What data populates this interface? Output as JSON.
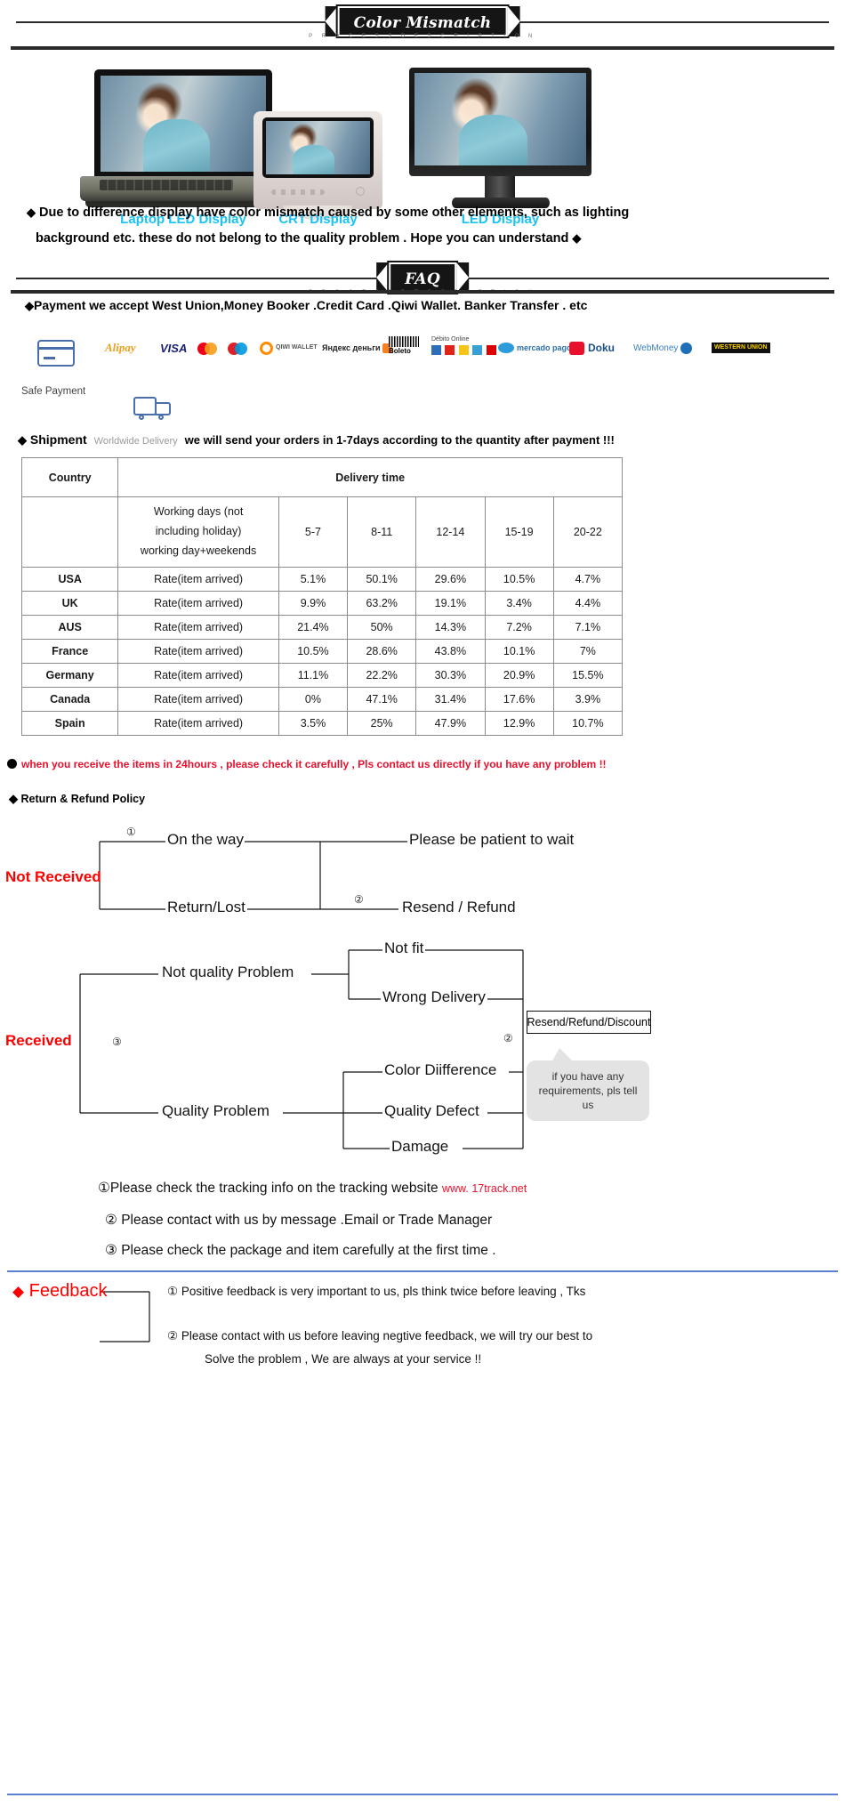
{
  "banners": [
    {
      "title": "Color Mismatch",
      "subtitle": "P R O C E S S   D E S C R I P T I O N"
    },
    {
      "title": "FAQ",
      "subtitle": "P R O C E S S   D E S C R I P T I O N"
    }
  ],
  "monitors": [
    {
      "label": "Laptop LED Display"
    },
    {
      "label": "CRT Display"
    },
    {
      "label": "LED  Display"
    }
  ],
  "color_mismatch": {
    "line1": "Due to difference display have color mismatch caused by some other elements, such as lighting",
    "line2": "background etc.  these do not belong to the quality problem . Hope you can understand",
    "diamond": "◆"
  },
  "payment": {
    "heading": "Payment we accept West Union,Money Booker .Credit Card .Qiwi Wallet. Banker Transfer . etc",
    "safe_payment_label": "Safe Payment",
    "logos": [
      {
        "name": "alipay",
        "text": "Alipay"
      },
      {
        "name": "visa",
        "text": "VISA"
      },
      {
        "name": "mastercard",
        "text": ""
      },
      {
        "name": "maestro",
        "text": ""
      },
      {
        "name": "qiwi-wallet",
        "text": "QIWI WALLET"
      },
      {
        "name": "yandex-dengi",
        "text": "Яндекс деньги"
      },
      {
        "name": "boleto",
        "text": "Boleto"
      },
      {
        "name": "debito-online",
        "text": "Débito Online"
      },
      {
        "name": "mercado-pago",
        "text": "mercado pago"
      },
      {
        "name": "doku",
        "text": "Doku"
      },
      {
        "name": "webmoney",
        "text": "WebMoney"
      },
      {
        "name": "western-union",
        "text": "WESTERN UNION"
      }
    ]
  },
  "shipment": {
    "title": "Shipment",
    "worldwide": "Worldwide Delivery",
    "note": "we will send your orders in 1-7days according to the quantity after payment  !!!"
  },
  "table": {
    "header": {
      "country": "Country",
      "delivery_time": "Delivery time"
    },
    "subheader": {
      "working_days": [
        "Working days (not",
        "including holiday)",
        "working day+weekends"
      ],
      "ranges": [
        "5-7",
        "8-11",
        "12-14",
        "15-19",
        "20-22"
      ]
    },
    "rate_label": "Rate(item arrived)",
    "rows": [
      {
        "country": "USA",
        "rate": "Rate(item arrived)",
        "values": [
          "5.1%",
          "50.1%",
          "29.6%",
          "10.5%",
          "4.7%"
        ]
      },
      {
        "country": "UK",
        "rate": "Rate(item arrived)",
        "values": [
          "9.9%",
          "63.2%",
          "19.1%",
          "3.4%",
          "4.4%"
        ]
      },
      {
        "country": "AUS",
        "rate": "Rate(item arrived)",
        "values": [
          "21.4%",
          "50%",
          "14.3%",
          "7.2%",
          "7.1%"
        ]
      },
      {
        "country": "France",
        "rate": "Rate(item arrived)",
        "values": [
          "10.5%",
          "28.6%",
          "43.8%",
          "10.1%",
          "7%"
        ]
      },
      {
        "country": "Germany",
        "rate": "Rate(item arrived)",
        "values": [
          "11.1%",
          "22.2%",
          "30.3%",
          "20.9%",
          "15.5%"
        ]
      },
      {
        "country": "Canada",
        "rate": "Rate(item arrived)",
        "values": [
          "0%",
          "47.1%",
          "31.4%",
          "17.6%",
          "3.9%"
        ]
      },
      {
        "country": "Spain",
        "rate": "Rate(item arrived)",
        "values": [
          "3.5%",
          "25%",
          "47.9%",
          "12.9%",
          "10.7%"
        ]
      }
    ]
  },
  "warning": "when you receive the items in 24hours , please check it carefully , Pls contact us directly if you have any problem !!",
  "return_policy_title": "Return & Refund Policy",
  "flow_not_received": {
    "group_label": "Not Received",
    "node_on_the_way": "On the way",
    "node_return_lost": "Return/Lost",
    "out_patient": "Please be patient to wait",
    "out_resend_refund": "Resend / Refund",
    "marker_1": "①",
    "marker_2": "②"
  },
  "flow_received": {
    "group_label": "Received",
    "node_not_quality": "Not quality Problem",
    "node_quality": "Quality Problem",
    "leaf_not_fit": "Not fit",
    "leaf_wrong_delivery": "Wrong Delivery",
    "leaf_color_difference": "Color Diifference",
    "leaf_quality_defect": "Quality Defect",
    "leaf_damage": "Damage",
    "result_box": "Resend/Refund/Discount",
    "bubble": "if you have any requirements, pls tell us",
    "marker_2": "②",
    "marker_3": "③"
  },
  "explanations": [
    {
      "marker": "①",
      "text": "Please check the tracking info on the tracking website",
      "link": "www. 17track.net"
    },
    {
      "marker": "②",
      "text": "Please contact with us by message .Email or Trade Manager",
      "link": ""
    },
    {
      "marker": "③",
      "text": "Please check the package and item carefully at the first time .",
      "link": ""
    }
  ],
  "feedback": {
    "title": "Feedback",
    "diamond": "◆",
    "items": [
      {
        "marker": "①",
        "lines": [
          "Positive feedback is very important to us, pls think twice before leaving , Tks"
        ]
      },
      {
        "marker": "②",
        "lines": [
          "Please contact with us before leaving negtive feedback, we will try our best to",
          "Solve the problem , We are always at your service !!"
        ]
      }
    ]
  }
}
